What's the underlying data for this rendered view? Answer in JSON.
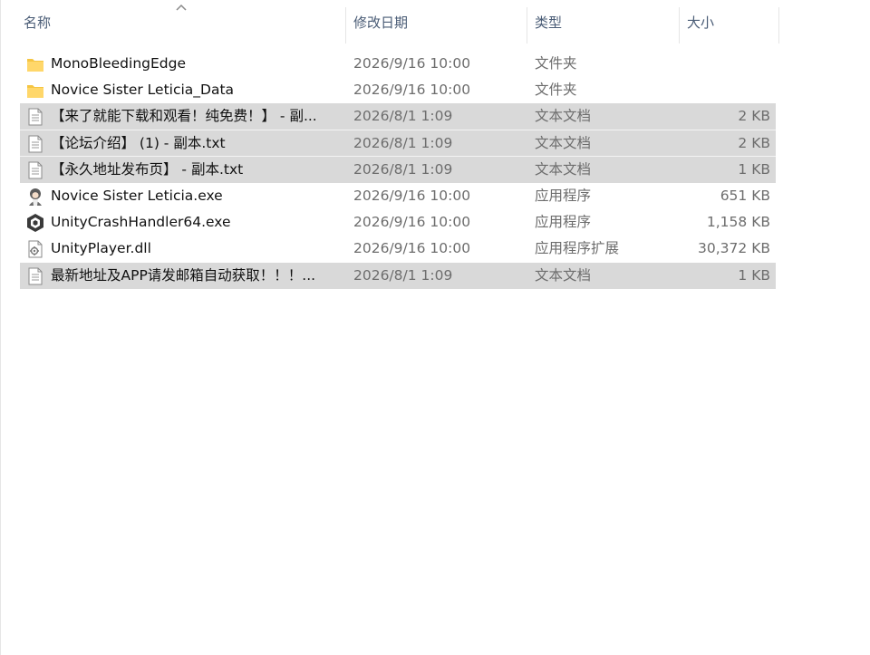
{
  "columns": {
    "name": "名称",
    "date": "修改日期",
    "type": "类型",
    "size": "大小"
  },
  "colors": {
    "header_text": "#4a5c76",
    "selection": "#d9d9d9",
    "folder": "#f5c542",
    "secondary_text": "#6d6d6d"
  },
  "files": [
    {
      "icon": "folder-icon",
      "name": "MonoBleedingEdge",
      "date": "2026/9/16 10:00",
      "type": "文件夹",
      "size": "",
      "selected": false
    },
    {
      "icon": "folder-icon",
      "name": "Novice Sister Leticia_Data",
      "date": "2026/9/16 10:00",
      "type": "文件夹",
      "size": "",
      "selected": false
    },
    {
      "icon": "text-file-icon",
      "name": "【来了就能下载和观看！纯免费！】 - 副...",
      "date": "2026/8/1 1:09",
      "type": "文本文档",
      "size": "2 KB",
      "selected": true
    },
    {
      "icon": "text-file-icon",
      "name": "【论坛介绍】 (1) - 副本.txt",
      "date": "2026/8/1 1:09",
      "type": "文本文档",
      "size": "2 KB",
      "selected": true
    },
    {
      "icon": "text-file-icon",
      "name": "【永久地址发布页】 - 副本.txt",
      "date": "2026/8/1 1:09",
      "type": "文本文档",
      "size": "1 KB",
      "selected": true
    },
    {
      "icon": "game-exe-icon",
      "name": "Novice Sister Leticia.exe",
      "date": "2026/9/16 10:00",
      "type": "应用程序",
      "size": "651 KB",
      "selected": false
    },
    {
      "icon": "unity-icon",
      "name": "UnityCrashHandler64.exe",
      "date": "2026/9/16 10:00",
      "type": "应用程序",
      "size": "1,158 KB",
      "selected": false
    },
    {
      "icon": "dll-file-icon",
      "name": "UnityPlayer.dll",
      "date": "2026/9/16 10:00",
      "type": "应用程序扩展",
      "size": "30,372 KB",
      "selected": false
    },
    {
      "icon": "text-file-icon",
      "name": "最新地址及APP请发邮箱自动获取！！！...",
      "date": "2026/8/1 1:09",
      "type": "文本文档",
      "size": "1 KB",
      "selected": true
    }
  ]
}
